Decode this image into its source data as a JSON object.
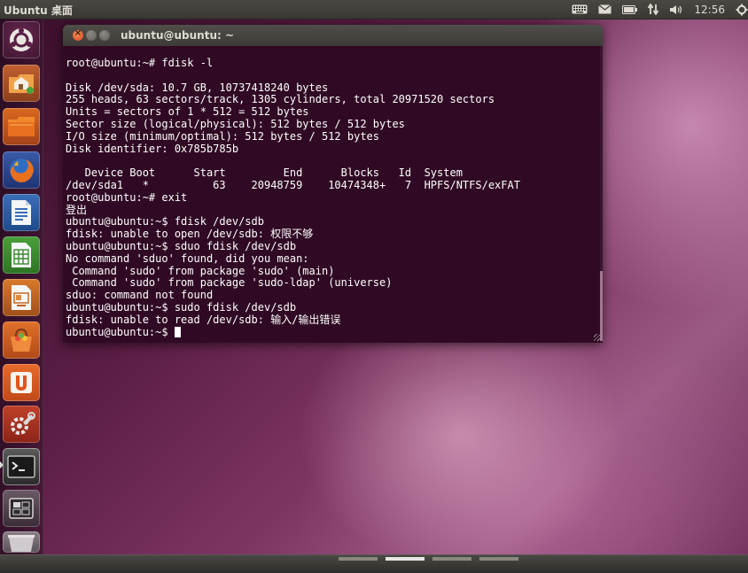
{
  "panel": {
    "title": "Ubuntu 桌面",
    "clock": "12:56"
  },
  "launcher": {
    "items": [
      {
        "name": "Dash",
        "icon": "ubuntu-logo-icon"
      },
      {
        "name": "Home Folder",
        "icon": "home-folder-icon"
      },
      {
        "name": "Files",
        "icon": "folder-icon"
      },
      {
        "name": "Firefox",
        "icon": "firefox-icon"
      },
      {
        "name": "LibreOffice Writer",
        "icon": "writer-icon"
      },
      {
        "name": "LibreOffice Calc",
        "icon": "calc-icon"
      },
      {
        "name": "LibreOffice Impress",
        "icon": "impress-icon"
      },
      {
        "name": "Software Center",
        "icon": "software-center-icon"
      },
      {
        "name": "Ubuntu One",
        "icon": "ubuntu-one-icon"
      },
      {
        "name": "System Settings",
        "icon": "settings-icon"
      },
      {
        "name": "Terminal",
        "icon": "terminal-icon"
      },
      {
        "name": "Workspace Switcher",
        "icon": "workspace-icon"
      },
      {
        "name": "Trash",
        "icon": "trash-icon"
      }
    ]
  },
  "window": {
    "title": "ubuntu@ubuntu: ~",
    "close_glyph": "×"
  },
  "terminal": {
    "lines": [
      "root@ubuntu:~# fdisk -l",
      "",
      "Disk /dev/sda: 10.7 GB, 10737418240 bytes",
      "255 heads, 63 sectors/track, 1305 cylinders, total 20971520 sectors",
      "Units = sectors of 1 * 512 = 512 bytes",
      "Sector size (logical/physical): 512 bytes / 512 bytes",
      "I/O size (minimum/optimal): 512 bytes / 512 bytes",
      "Disk identifier: 0x785b785b",
      "",
      "   Device Boot      Start         End      Blocks   Id  System",
      "/dev/sda1   *          63    20948759    10474348+   7  HPFS/NTFS/exFAT",
      "root@ubuntu:~# exit",
      "登出",
      "ubuntu@ubuntu:~$ fdisk /dev/sdb",
      "fdisk: unable to open /dev/sdb: 权限不够",
      "ubuntu@ubuntu:~$ sduo fdisk /dev/sdb",
      "No command 'sduo' found, did you mean:",
      " Command 'sudo' from package 'sudo' (main)",
      " Command 'sudo' from package 'sudo-ldap' (universe)",
      "sduo: command not found",
      "ubuntu@ubuntu:~$ sudo fdisk /dev/sdb",
      "fdisk: unable to read /dev/sdb: 输入/输出错误",
      "ubuntu@ubuntu:~$ "
    ]
  },
  "colors": {
    "terminal_bg": "#300a24",
    "panel_bg": "#3c3b37",
    "close_button": "#e2582a"
  }
}
